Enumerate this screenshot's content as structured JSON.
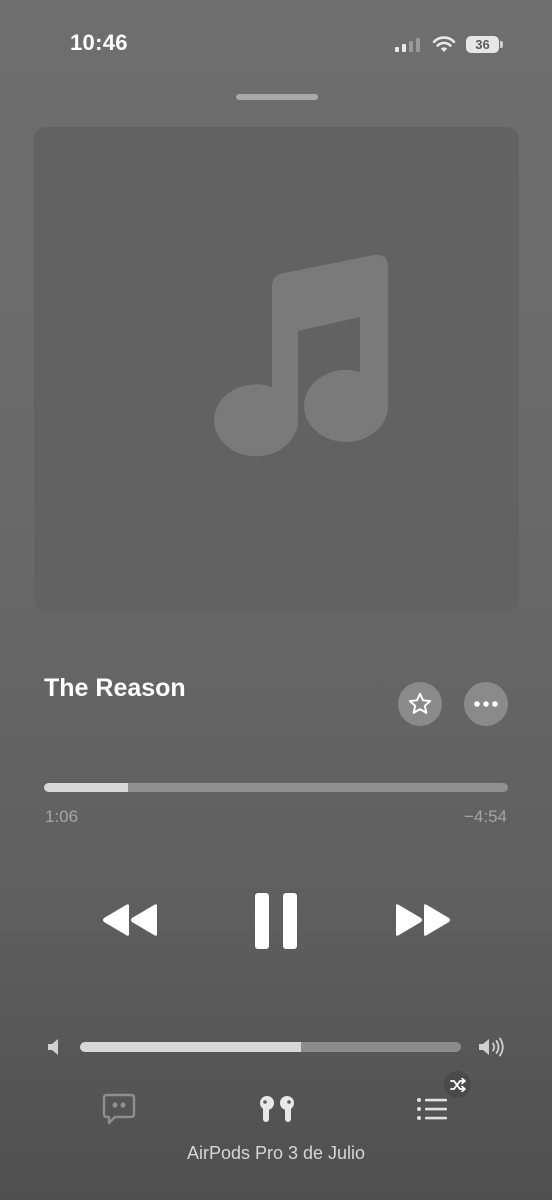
{
  "status_bar": {
    "time": "10:46",
    "battery_level": "36"
  },
  "now_playing": {
    "title": "The Reason",
    "artwork_icon": "music-note-icon"
  },
  "progress": {
    "elapsed": "1:06",
    "remaining": "−4:54",
    "fraction": 0.18
  },
  "volume": {
    "fraction": 0.58
  },
  "output_device": {
    "label": "AirPods Pro 3 de Julio"
  },
  "colors": {
    "background": "#6a6a6a",
    "foreground": "#ffffff",
    "secondary_text": "#a5a5a5"
  }
}
